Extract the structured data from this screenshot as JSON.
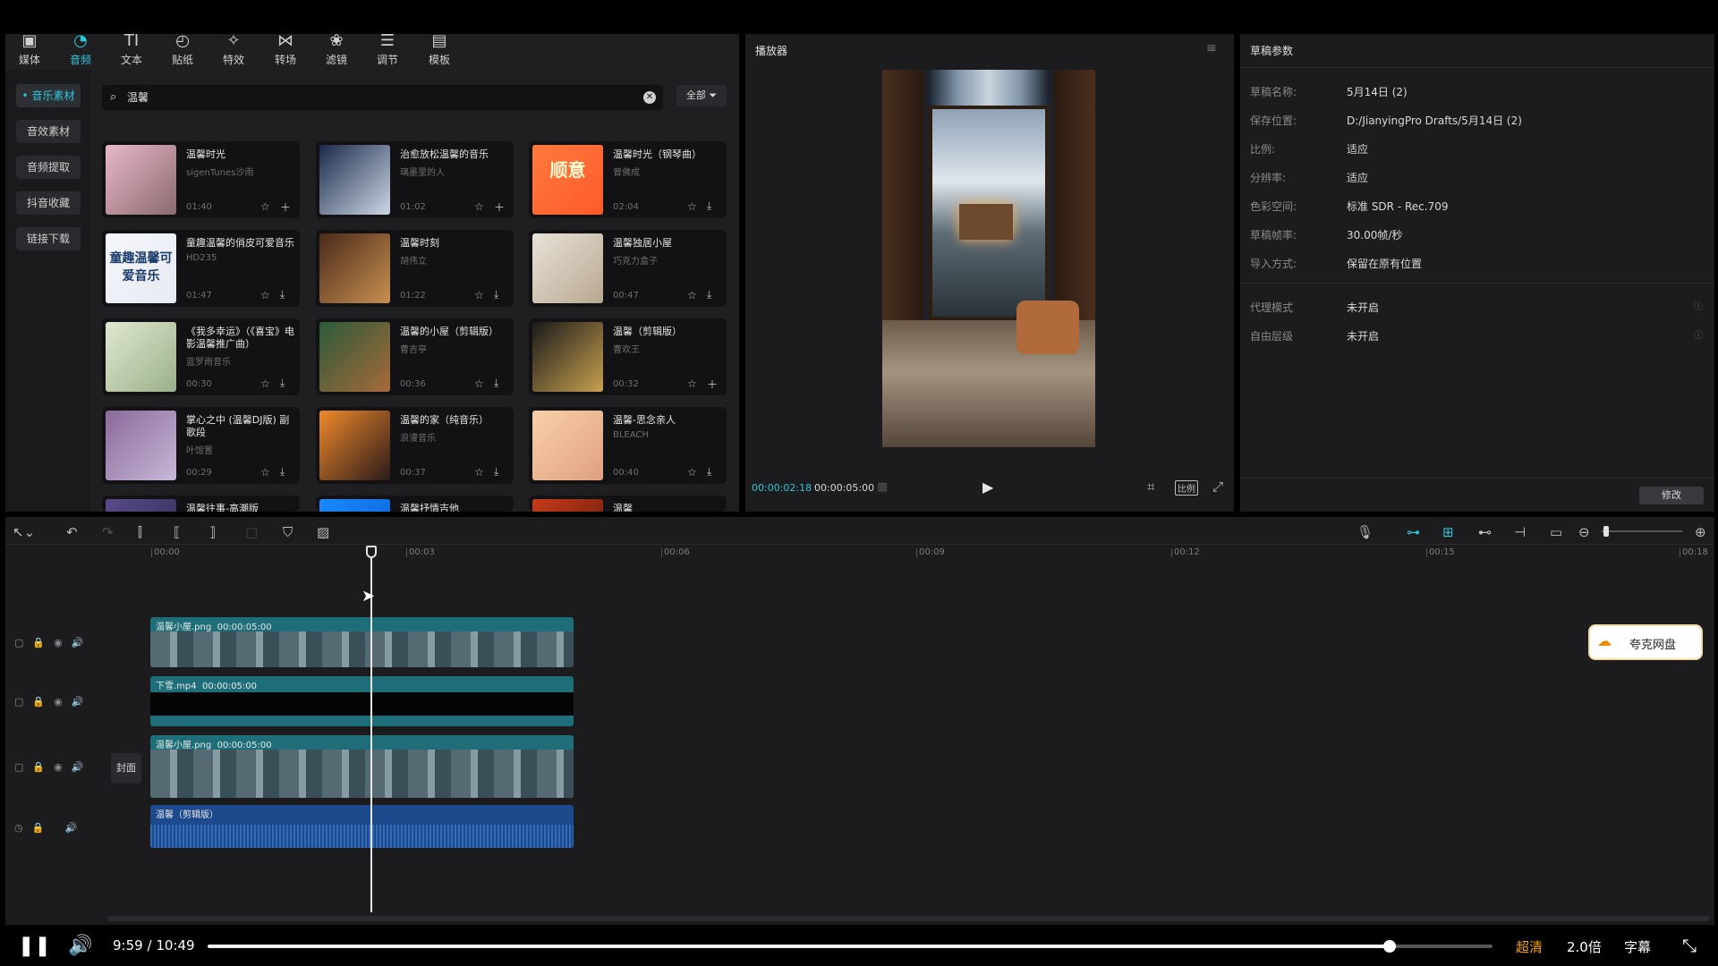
{
  "toolbar": {
    "tabs": [
      {
        "icon": "media-icon",
        "label": "媒体"
      },
      {
        "icon": "audio-icon",
        "label": "音频"
      },
      {
        "icon": "text-icon",
        "label": "文本"
      },
      {
        "icon": "sticker-icon",
        "label": "贴纸"
      },
      {
        "icon": "effects-icon",
        "label": "特效"
      },
      {
        "icon": "transition-icon",
        "label": "转场"
      },
      {
        "icon": "filter-icon",
        "label": "滤镜"
      },
      {
        "icon": "adjust-icon",
        "label": "调节"
      },
      {
        "icon": "template-icon",
        "label": "模板"
      }
    ],
    "active_index": 1
  },
  "sidebar": {
    "items": [
      "音乐素材",
      "音效素材",
      "音频提取",
      "抖音收藏",
      "链接下载"
    ],
    "active_index": 0
  },
  "search": {
    "value": "温馨",
    "filter_label": "全部"
  },
  "music_cards": [
    {
      "title": "温馨时光",
      "artist": "sigenTunes沙雨",
      "duration": "01:40",
      "action": "add"
    },
    {
      "title": "治愈放松温馨的音乐",
      "artist": "璃墨里的人",
      "duration": "01:02",
      "action": "add"
    },
    {
      "title": "温馨时光（钢琴曲）",
      "artist": "曾佛成",
      "duration": "02:04",
      "action": "download",
      "thumb_text": "顺意"
    },
    {
      "title": "童趣温馨的俏皮可爱音乐",
      "artist": "HD235",
      "duration": "01:47",
      "action": "download",
      "thumb_text": "童趣温馨可爱音乐"
    },
    {
      "title": "温馨时刻",
      "artist": "胡伟立",
      "duration": "01:22",
      "action": "download"
    },
    {
      "title": "温馨独居小屋",
      "artist": "巧克力盒子",
      "duration": "00:47",
      "action": "download"
    },
    {
      "title": "《我多幸运》（《喜宝》电影温馨推广曲）",
      "artist": "蓝罗雨音乐",
      "duration": "00:30",
      "action": "download"
    },
    {
      "title": "温馨的小屋（剪辑版）",
      "artist": "曹吉亭",
      "duration": "00:36",
      "action": "download"
    },
    {
      "title": "温馨（剪辑版）",
      "artist": "曹欢王",
      "duration": "00:32",
      "action": "add"
    },
    {
      "title": "掌心之中 (温馨DJ版) 副歌段",
      "artist": "叶馆置",
      "duration": "00:29",
      "action": "download"
    },
    {
      "title": "温馨的家（纯音乐）",
      "artist": "浪漫音乐",
      "duration": "00:37",
      "action": "download"
    },
    {
      "title": "温馨-思念亲人",
      "artist": "BLEACH",
      "duration": "00:40",
      "action": "download"
    },
    {
      "title": "温馨往事-高潮版",
      "artist": "",
      "duration": "",
      "action": ""
    },
    {
      "title": "温馨抒情吉他",
      "artist": "",
      "duration": "",
      "action": ""
    },
    {
      "title": "温馨",
      "artist": "",
      "duration": "",
      "action": ""
    }
  ],
  "player": {
    "title": "播放器",
    "current_time": "00:00:02:18",
    "total_time": "00:00:05:00",
    "ratio_label": "比例"
  },
  "draft": {
    "title": "草稿参数",
    "props": [
      {
        "label": "草稿名称:",
        "value": "5月14日 (2)"
      },
      {
        "label": "保存位置:",
        "value": "D:/JianyingPro Drafts/5月14日 (2)"
      },
      {
        "label": "比例:",
        "value": "适应"
      },
      {
        "label": "分辨率:",
        "value": "适应"
      },
      {
        "label": "色彩空间:",
        "value": "标准 SDR - Rec.709"
      },
      {
        "label": "草稿帧率:",
        "value": "30.00帧/秒"
      },
      {
        "label": "导入方式:",
        "value": "保留在原有位置"
      }
    ],
    "extra_props": [
      {
        "label": "代理模式",
        "value": "未开启"
      },
      {
        "label": "自由层级",
        "value": "未开启"
      }
    ],
    "modify_label": "修改"
  },
  "timeline": {
    "ticks": [
      "00:00",
      "00:03",
      "00:06",
      "00:09",
      "00:12",
      "00:15",
      "00:18"
    ],
    "cover_label": "封面",
    "clips": [
      {
        "name": "温馨小屋.png",
        "duration": "00:00:05:00"
      },
      {
        "name": "下雪.mp4",
        "duration": "00:00:05:00"
      },
      {
        "name": "温馨小屋.png",
        "duration": "00:00:05:00"
      },
      {
        "name": "温馨（剪辑版）",
        "duration": ""
      }
    ],
    "cloud_badge": "夸克网盘"
  },
  "video_player": {
    "current": "9:59",
    "separator": "/",
    "total": "10:49",
    "progress": 0.92,
    "quality": "超清",
    "speed": "2.0倍",
    "subtitle": "字幕",
    "accent": "#f0a100"
  },
  "colors": {
    "accent": "#2fc5d8",
    "clip_video": "#1d6e78",
    "clip_audio": "#1c4a8c"
  }
}
